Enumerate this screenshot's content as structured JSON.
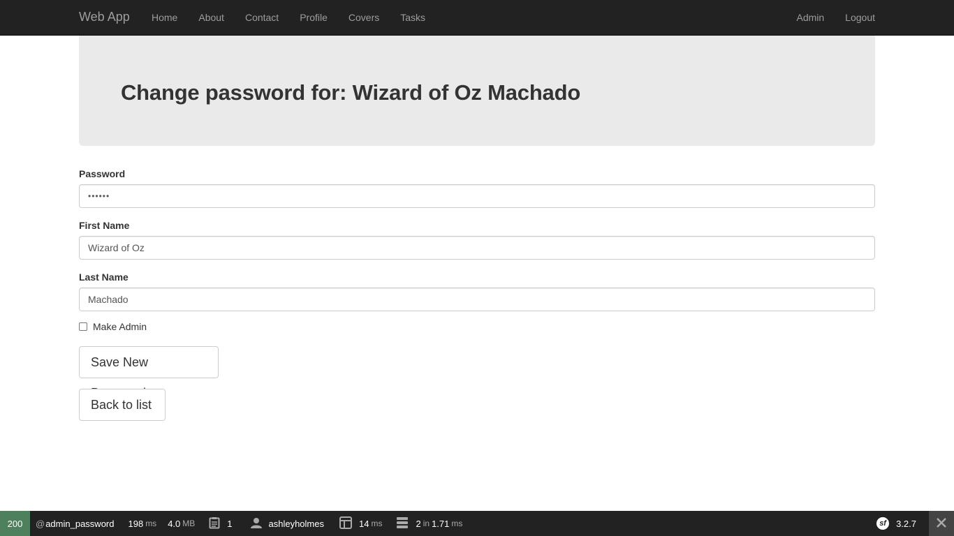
{
  "navbar": {
    "brand": "Web App",
    "left_items": [
      "Home",
      "About",
      "Contact",
      "Profile",
      "Covers",
      "Tasks"
    ],
    "right_items": [
      "Admin",
      "Logout"
    ]
  },
  "header": {
    "title": "Change password for: Wizard of Oz Machado"
  },
  "form": {
    "password_label": "Password",
    "password_value": "••••••",
    "first_name_label": "First Name",
    "first_name_value": "Wizard of Oz",
    "last_name_label": "Last Name",
    "last_name_value": "Machado",
    "make_admin_label": "Make Admin",
    "make_admin_checked": false,
    "save_label": "Save New Password",
    "back_label": "Back to list"
  },
  "toolbar": {
    "status_code": "200",
    "route_prefix": "@",
    "route": "admin_password",
    "time_value": "198",
    "time_unit": "ms",
    "memory_value": "4.0",
    "memory_unit": "MB",
    "logs_count": "1",
    "user": "ashleyholmes",
    "render_value": "14",
    "render_unit": "ms",
    "db_queries": "2",
    "db_in": "in",
    "db_time": "1.71",
    "db_unit": "ms",
    "version": "3.2.7",
    "status_color": "#4f805d"
  }
}
